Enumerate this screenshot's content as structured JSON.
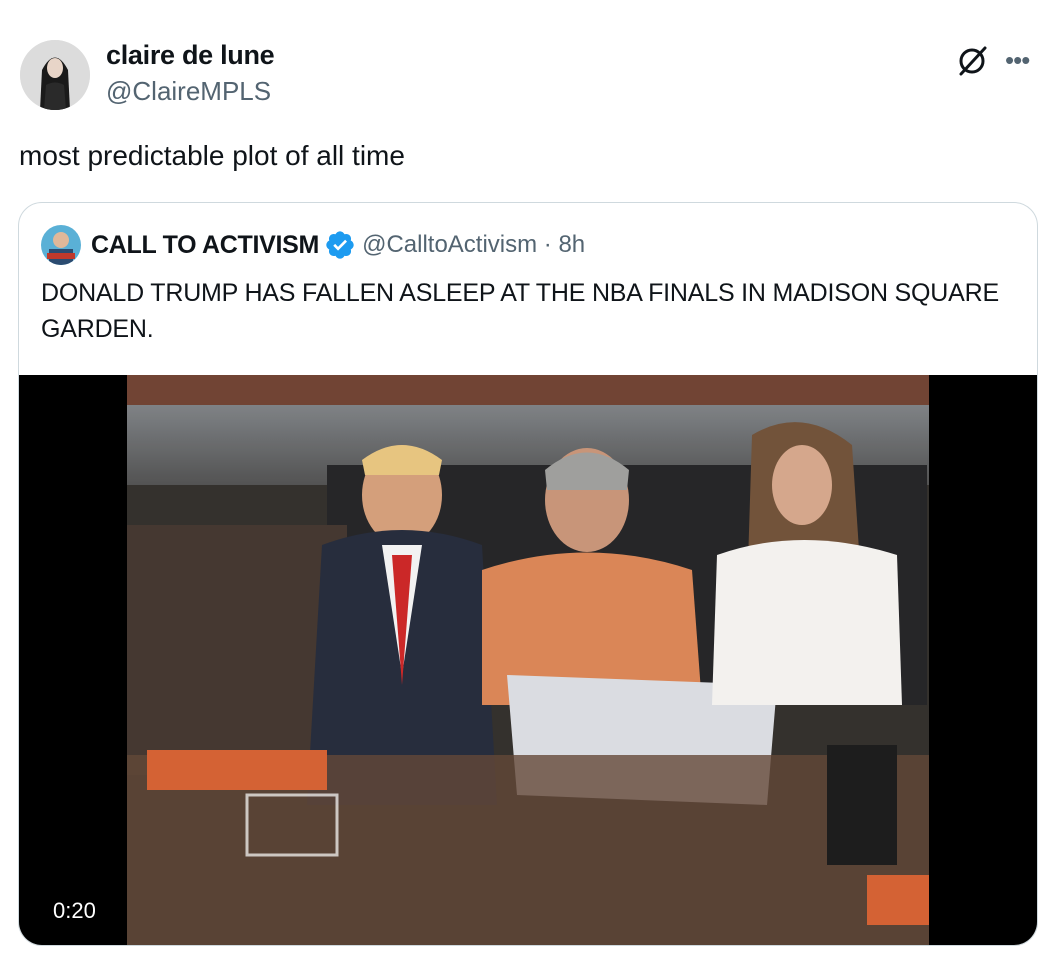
{
  "author": {
    "display_name": "claire de lune",
    "handle": "@ClaireMPLS"
  },
  "tweet": {
    "text": "most predictable plot of all time"
  },
  "icons": {
    "grok": "grok-icon",
    "more": "more-icon",
    "verified": "verified-badge-icon"
  },
  "quoted_tweet": {
    "display_name": "CALL TO ACTIVISM",
    "handle_time": "@CalltoActivism · 8h",
    "text": "DONALD TRUMP HAS FALLEN ASLEEP AT THE NBA FINALS IN MADISON SQUARE GARDEN.",
    "video": {
      "duration": "0:20"
    }
  },
  "colors": {
    "text_primary": "#0f1419",
    "text_secondary": "#536471",
    "verified_blue": "#1d9bf0",
    "border": "#cfd9de"
  }
}
